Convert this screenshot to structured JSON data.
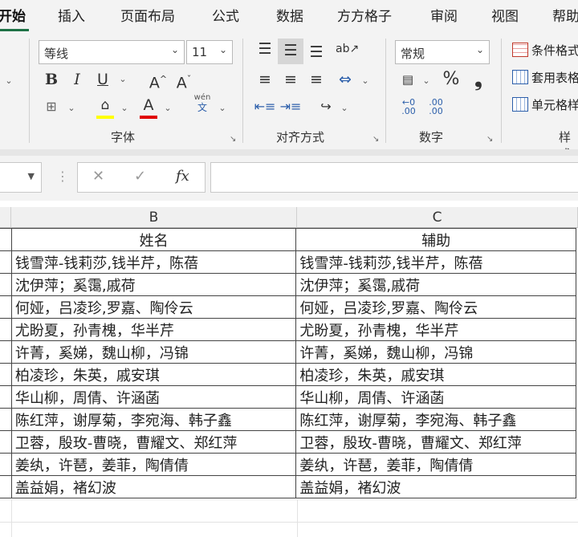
{
  "ribbon_tabs": [
    "开始",
    "插入",
    "页面布局",
    "公式",
    "数据",
    "方方格子",
    "审阅",
    "视图",
    "帮助"
  ],
  "font_group": {
    "font_name": "等线",
    "font_size": "11",
    "bold": "B",
    "italic": "I",
    "underline": "U",
    "grow_font": "A",
    "shrink_font": "A",
    "phonetic": "wén",
    "phonetic_sub": "文",
    "label": "字体",
    "highlight_color": "#ffff00",
    "font_color": "#e00000"
  },
  "align_group": {
    "label": "对齐方式"
  },
  "number_group": {
    "format": "常规",
    "percent": "%",
    "comma": "❟",
    "increase_decimal": ".00",
    "decrease_decimal": ".00",
    "label": "数字"
  },
  "styles_group": {
    "items": [
      "条件格式",
      "套用表格",
      "单元格样"
    ],
    "label": "样式"
  },
  "formula_bar": {
    "cancel": "✕",
    "enter": "✓",
    "fx": "fx"
  },
  "column_headers": [
    "B",
    "C"
  ],
  "table": {
    "headers": [
      "姓名",
      "辅助"
    ],
    "rows": [
      [
        "钱雪萍-钱莉莎,钱半芹，陈蓓",
        "钱雪萍-钱莉莎,钱半芹，陈蓓"
      ],
      [
        "沈伊萍；奚霭,戚荷",
        "沈伊萍；奚霭,戚荷"
      ],
      [
        "何娅，吕凌珍,罗嘉、陶伶云",
        "何娅，吕凌珍,罗嘉、陶伶云"
      ],
      [
        "尤盼夏，孙青槐，华半芹",
        "尤盼夏，孙青槐，华半芹"
      ],
      [
        "许菁，奚娣，魏山柳，冯锦",
        "许菁，奚娣，魏山柳，冯锦"
      ],
      [
        "柏凌珍，朱英，戚安琪",
        "柏凌珍，朱英，戚安琪"
      ],
      [
        "华山柳，周倩、许涵菡",
        "华山柳，周倩、许涵菡"
      ],
      [
        "陈红萍，谢厚菊，李宛海、韩子鑫",
        "陈红萍，谢厚菊，李宛海、韩子鑫"
      ],
      [
        "卫蓉，殷玫-曹晓，曹耀文、郑红萍",
        "卫蓉，殷玫-曹晓，曹耀文、郑红萍"
      ],
      [
        "姜纨，许琶，姜菲，陶倩倩",
        "姜纨，许琶，姜菲，陶倩倩"
      ],
      [
        "盖益娟，褚幻波",
        "盖益娟，褚幻波"
      ]
    ]
  }
}
